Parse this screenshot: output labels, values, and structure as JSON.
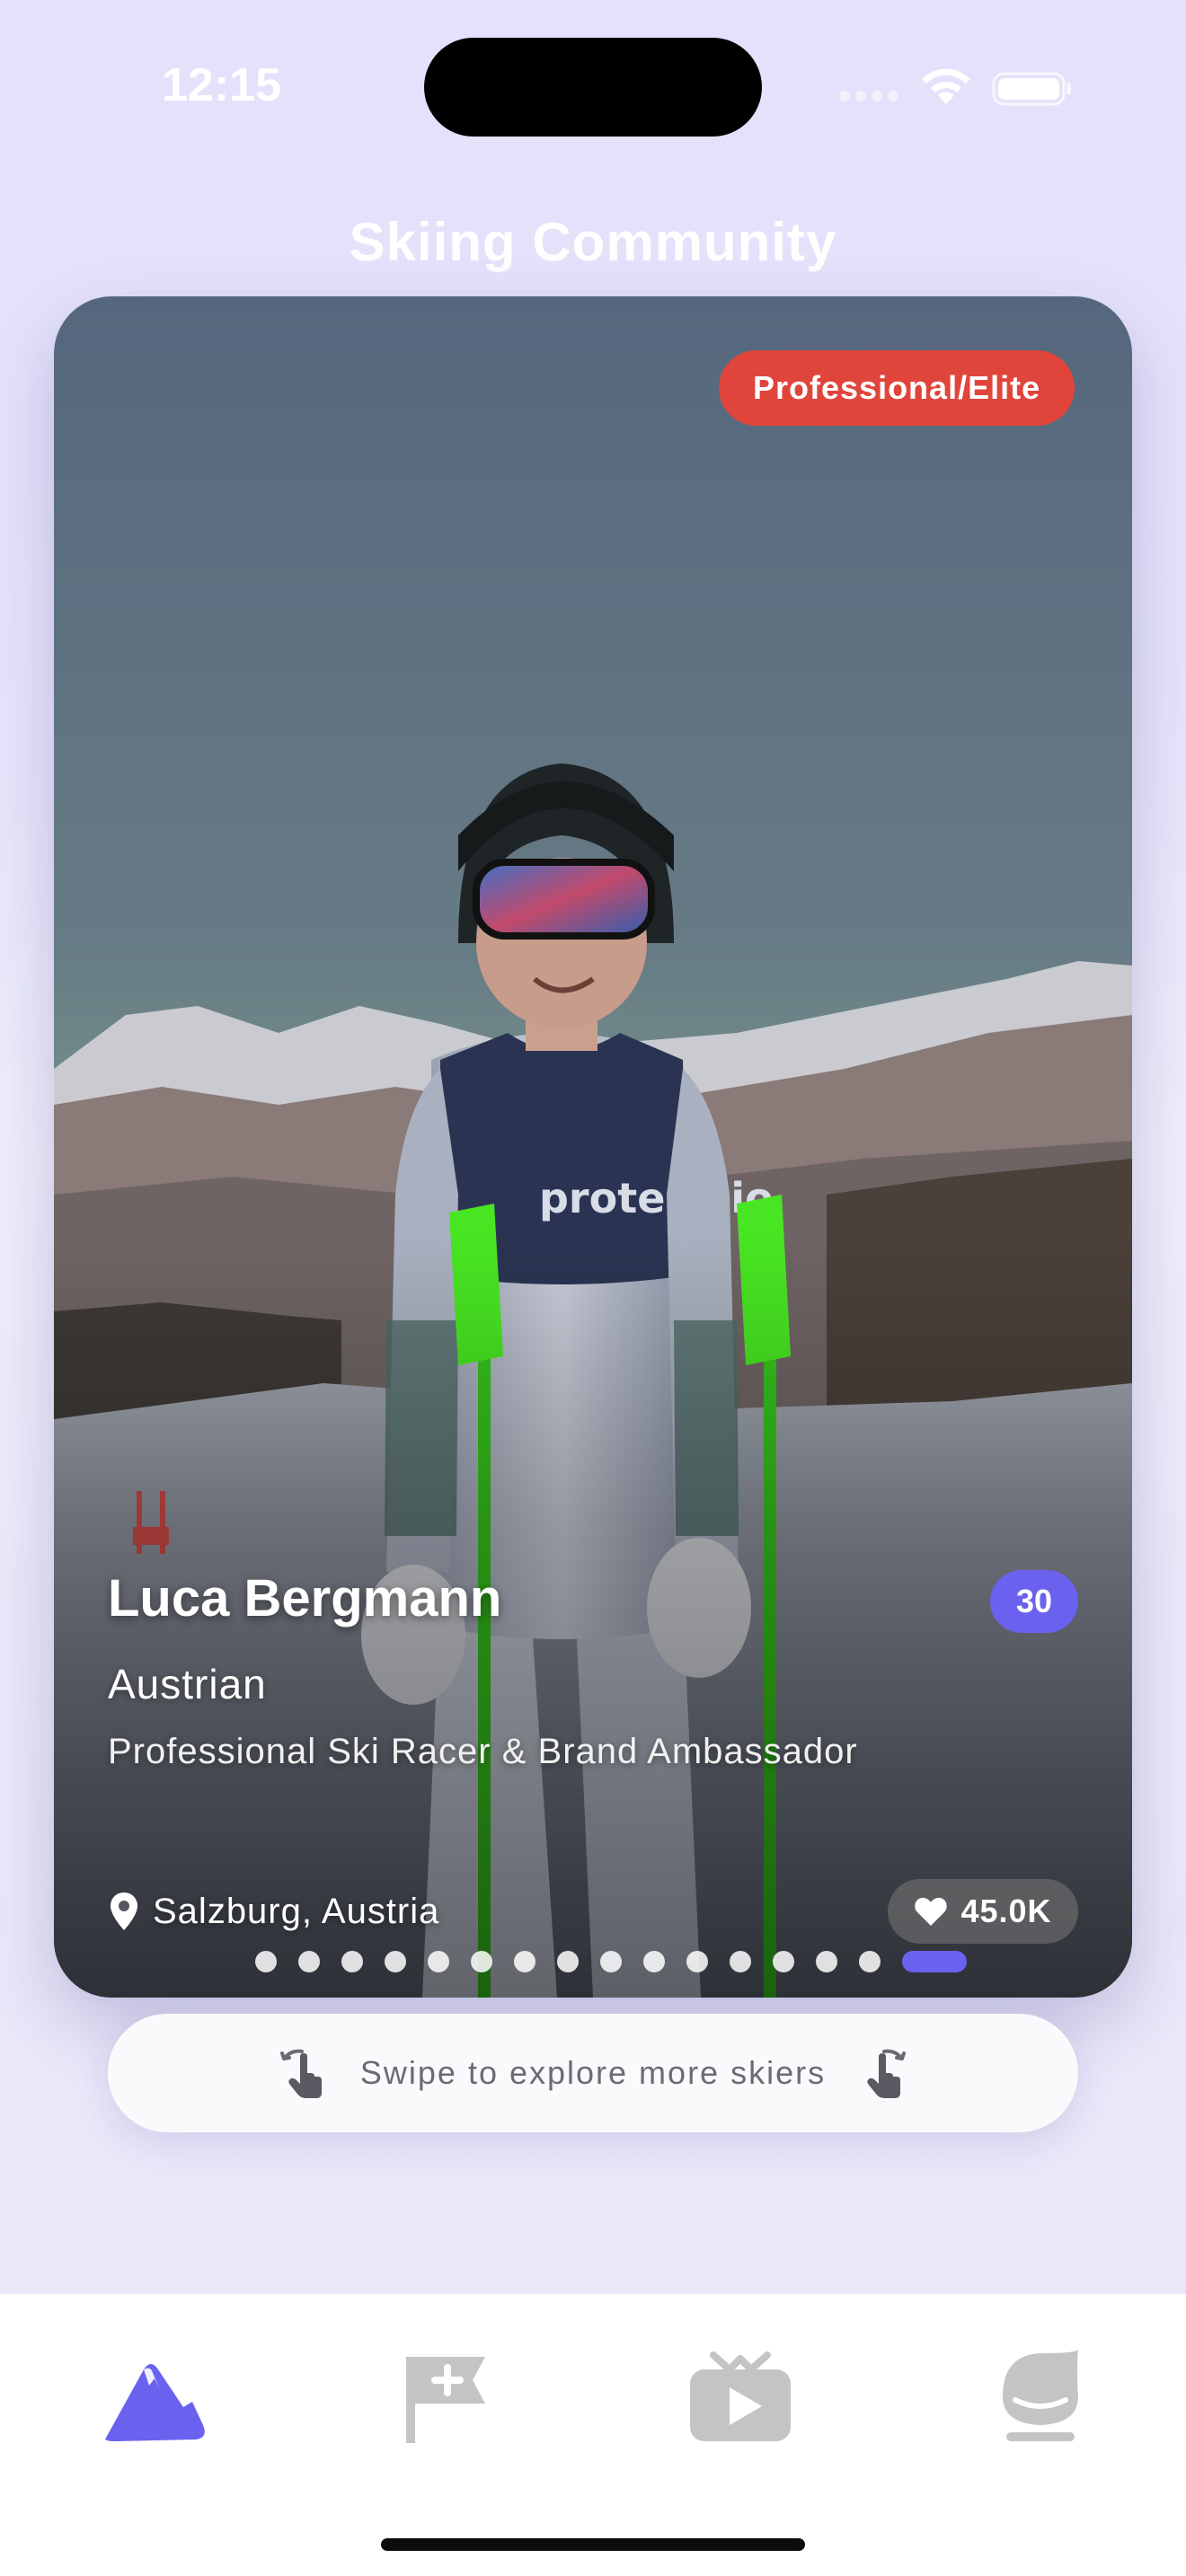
{
  "status_bar": {
    "time": "12:15",
    "wifi_icon": "wifi-icon",
    "battery_icon": "battery-icon"
  },
  "header": {
    "title": "Skiing Community"
  },
  "profile_card": {
    "photo": "skier-photo",
    "level_badge": "Professional/Elite",
    "name": "Luca Bergmann",
    "age": "30",
    "nationality": "Austrian",
    "occupation": "Professional Ski Racer & Brand Ambassador",
    "location": "Salzburg, Austria",
    "location_icon": "map-pin-icon",
    "likes": "45.0K",
    "likes_icon": "heart-icon",
    "pagination": {
      "total_pages": 16,
      "current_page": 16
    }
  },
  "swipe_hint": {
    "text": "Swipe to explore more skiers",
    "icon": "swipe-hand-icon"
  },
  "bottom_nav": {
    "tabs": [
      {
        "icon": "mountain-icon",
        "active": true
      },
      {
        "icon": "flag-plus-icon",
        "active": false
      },
      {
        "icon": "video-play-icon",
        "active": false
      },
      {
        "icon": "profile-face-icon",
        "active": false
      }
    ]
  },
  "colors": {
    "accent": "#6a62ee",
    "level_badge": "#e0453c",
    "inactive_tab": "#c4c4c4",
    "background_top": "#e3e1fb"
  }
}
